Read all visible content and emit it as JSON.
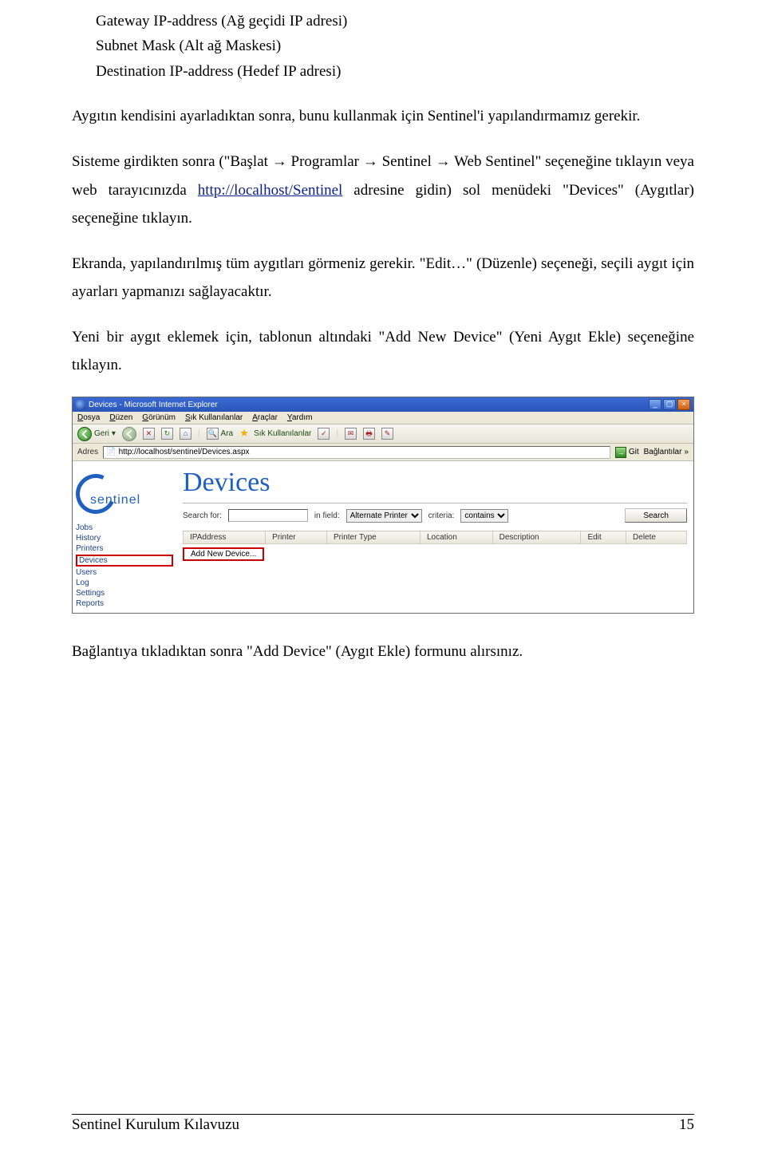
{
  "indent_lines": [
    "Gateway IP-address (Ağ geçidi IP adresi)",
    "Subnet Mask (Alt ağ Maskesi)",
    "Destination IP-address (Hedef IP adresi)"
  ],
  "para1": "Aygıtın kendisini ayarladıktan sonra, bunu kullanmak için Sentinel'i yapılandırmamız gerekir.",
  "para2_a": "Sisteme girdikten sonra (\"Başlat → Programlar → Sentinel → Web Sentinel\" seçeneğine tıklayın veya web tarayıcınızda ",
  "para2_link": "http://localhost/Sentinel",
  "para2_b": " adresine gidin) sol menüdeki \"Devices\" (Aygıtlar) seçeneğine tıklayın.",
  "para3": "Ekranda, yapılandırılmış tüm aygıtları görmeniz gerekir. \"Edit…\" (Düzenle) seçeneği, seçili aygıt için ayarları yapmanızı sağlayacaktır.",
  "para4": "Yeni bir aygıt eklemek için, tablonun altındaki \"Add New Device\" (Yeni Aygıt Ekle) seçeneğine tıklayın.",
  "para5": "Bağlantıya tıkladıktan sonra \"Add Device\" (Aygıt Ekle) formunu alırsınız.",
  "screenshot": {
    "title": "Devices - Microsoft Internet Explorer",
    "menu": [
      "Dosya",
      "Düzen",
      "Görünüm",
      "Sık Kullanılanlar",
      "Araçlar",
      "Yardım"
    ],
    "toolbar": {
      "back": "Geri",
      "search": "Ara",
      "fav": "Sık Kullanılanlar"
    },
    "addr_label": "Adres",
    "addr_url": "http://localhost/sentinel/Devices.aspx",
    "go_label": "Git",
    "links_label": "Bağlantılar",
    "logo_text": "sentinel",
    "page_heading": "Devices",
    "nav_items": [
      "Jobs",
      "History",
      "Printers",
      "Devices",
      "Users",
      "Log",
      "Settings",
      "Reports"
    ],
    "nav_selected": "Devices",
    "search_for_label": "Search for:",
    "in_field_label": "in field:",
    "in_field_value": "Alternate Printer",
    "criteria_label": "criteria:",
    "criteria_value": "contains",
    "search_button": "Search",
    "columns": [
      "IPAddress",
      "Printer",
      "Printer Type",
      "Location",
      "Description",
      "Edit",
      "Delete"
    ],
    "add_new": "Add New Device..."
  },
  "footer": {
    "doc_title": "Sentinel Kurulum Kılavuzu",
    "page_num": "15"
  }
}
